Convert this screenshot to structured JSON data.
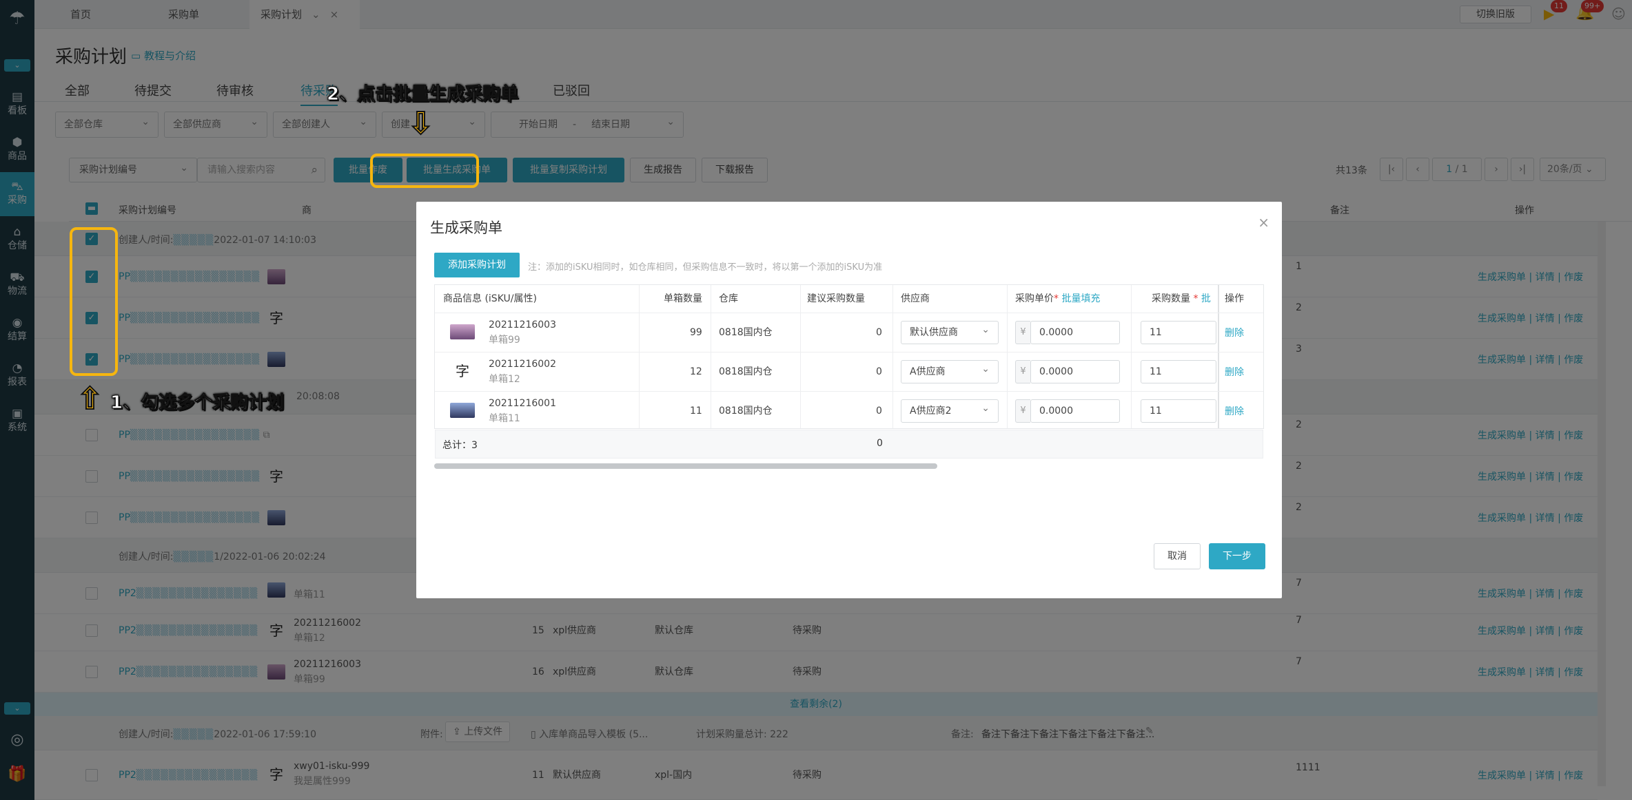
{
  "sidebar": {
    "items": [
      {
        "label": "看板",
        "icon": "dashboard-icon",
        "glyph": "▤"
      },
      {
        "label": "商品",
        "icon": "cube-icon",
        "glyph": "⬢"
      },
      {
        "label": "采购",
        "icon": "cart-icon",
        "glyph": "🛒"
      },
      {
        "label": "仓储",
        "icon": "warehouse-icon",
        "glyph": "⌂"
      },
      {
        "label": "物流",
        "icon": "truck-icon",
        "glyph": "⛟"
      },
      {
        "label": "结算",
        "icon": "coin-icon",
        "glyph": "◉"
      },
      {
        "label": "报表",
        "icon": "chart-icon",
        "glyph": "◔"
      },
      {
        "label": "系统",
        "icon": "system-icon",
        "glyph": "▣"
      }
    ],
    "active": "采购"
  },
  "topbar": {
    "tabs": [
      {
        "label": "首页"
      },
      {
        "label": "采购单"
      },
      {
        "label": "采购计划"
      }
    ],
    "switch_old": "切换旧版",
    "badge_a": "11",
    "badge_b": "99+"
  },
  "page": {
    "title": "采购计划",
    "tutorial": "教程与介绍",
    "status_tabs": [
      "全部",
      "待提交",
      "待审核",
      "待采购",
      "已驳回"
    ],
    "filters": {
      "warehouse": "全部仓库",
      "supplier": "全部供应商",
      "creator": "全部创建人",
      "creator2": "创建",
      "start_date": "开始日期",
      "date_sep": "-",
      "end_date": "结束日期"
    },
    "toolbar": {
      "search_field": "采购计划编号",
      "search_placeholder": "请输入搜索内容",
      "batch_void": "批量作废",
      "batch_generate": "批量生成采购单",
      "batch_copy": "批量复制采购计划",
      "gen_report": "生成报告",
      "download_report": "下载报告"
    },
    "pager": {
      "total": "共13条",
      "page": "1",
      "pages": "/ 1",
      "page_size": "20条/页"
    },
    "table": {
      "headers": {
        "code": "采购计划编号",
        "goods": "商",
        "remark": "备注",
        "ops": "操作"
      },
      "groups": [
        {
          "label": "创建人/时间:",
          "time": "2022-01-07 14:10:03"
        },
        {
          "time": "20:08:08"
        },
        {
          "label": "创建人/时间:",
          "time": "1/2022-01-06 20:02:24"
        },
        {
          "label": "创建人/时间:",
          "time": "2022-01-06 17:59:10",
          "attach_label": "附件:",
          "upload": "上传文件",
          "template": "入库单商品导入模板 (5...",
          "plan_total": "计划采购量总计:  222",
          "note_label": "备注:",
          "note": "备注下备注下备注下备注下备注下备注..."
        }
      ],
      "rows": [
        {
          "code": "PP",
          "remark": "1"
        },
        {
          "code": "PP",
          "remark": "2"
        },
        {
          "code": "PP",
          "remark": "3"
        },
        {
          "code": "PP",
          "remark": "2"
        },
        {
          "code": "PP",
          "remark": "2"
        },
        {
          "code": "PP",
          "remark": "2"
        },
        {
          "code": "PP2",
          "sku": "",
          "sub": "单箱11",
          "remark": "7"
        },
        {
          "code": "PP2",
          "sku": "20211216002",
          "sub": "单箱12",
          "qty": "15",
          "supplier": "xpl供应商",
          "warehouse": "默认仓库",
          "status": "待采购",
          "remark": "7"
        },
        {
          "code": "PP2",
          "sku": "20211216003",
          "sub": "单箱99",
          "qty": "16",
          "supplier": "xpl供应商",
          "warehouse": "默认仓库",
          "status": "待采购",
          "remark": "7"
        },
        {
          "code": "PP2",
          "sku": "xwy01-isku-999",
          "sub": "我是属性999",
          "qty": "11",
          "supplier": "默认供应商",
          "warehouse": "xpl-国内",
          "status": "待采购",
          "remark": "1111"
        }
      ],
      "ops": {
        "gen": "生成采购单",
        "detail": "详情",
        "void": "作废",
        "sep": "|"
      },
      "view_more": "查看剩余(2)"
    }
  },
  "modal": {
    "title": "生成采购单",
    "add_plan": "添加采购计划",
    "note": "注：添加的iSKU相同时，如仓库相同，但采购信息不一致时，将以第一个添加的iSKU为准",
    "headers": {
      "goods": "商品信息 (iSKU/属性)",
      "box_qty": "单箱数量",
      "warehouse": "仓库",
      "suggest": "建议采购数量",
      "supplier": "供应商",
      "price": "采购单价",
      "star": "*",
      "fill": "批量填充",
      "qty": "采购数量",
      "fill2": "批",
      "op": "操作"
    },
    "rows": [
      {
        "sku": "20211216003",
        "sub": "单箱99",
        "box_qty": "99",
        "warehouse": "0818国内仓",
        "suggest": "0",
        "supplier": "默认供应商",
        "currency": "¥",
        "price": "0.0000",
        "qty": "11",
        "del": "删除"
      },
      {
        "sku": "20211216002",
        "sub": "单箱12",
        "box_qty": "12",
        "warehouse": "0818国内仓",
        "suggest": "0",
        "supplier": "A供应商",
        "currency": "¥",
        "price": "0.0000",
        "qty": "11",
        "del": "删除"
      },
      {
        "sku": "20211216001",
        "sub": "单箱11",
        "box_qty": "11",
        "warehouse": "0818国内仓",
        "suggest": "0",
        "supplier": "A供应商2",
        "currency": "¥",
        "price": "0.0000",
        "qty": "11",
        "del": "删除"
      }
    ],
    "total_label": "总计：3",
    "total_suggest": "0",
    "cancel": "取消",
    "next": "下一步"
  },
  "annotations": {
    "step1": "1、勾选多个采购计划",
    "step2": "2、点击批量生成采购单"
  }
}
